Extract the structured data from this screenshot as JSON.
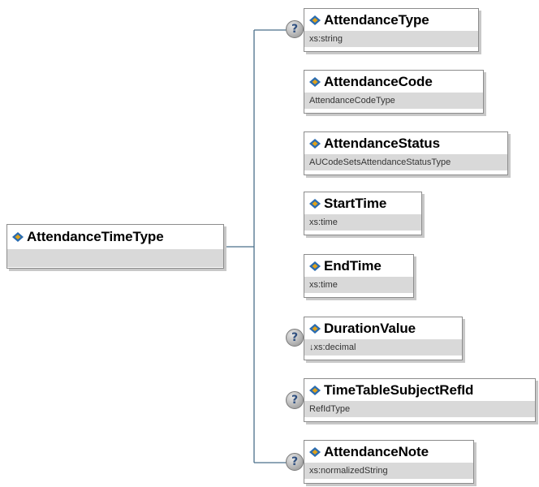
{
  "root": {
    "name": "AttendanceTimeType",
    "type": ""
  },
  "optional_marker": "?",
  "elements": [
    {
      "name": "AttendanceType",
      "type": "xs:string",
      "optional": true
    },
    {
      "name": "AttendanceCode",
      "type": "AttendanceCodeType",
      "optional": false
    },
    {
      "name": "AttendanceStatus",
      "type": "AUCodeSetsAttendanceStatusType",
      "optional": false
    },
    {
      "name": "StartTime",
      "type": "xs:time",
      "optional": false
    },
    {
      "name": "EndTime",
      "type": "xs:time",
      "optional": false
    },
    {
      "name": "DurationValue",
      "type": "↓xs:decimal",
      "optional": true
    },
    {
      "name": "TimeTableSubjectRefId",
      "type": "RefIdType",
      "optional": true
    },
    {
      "name": "AttendanceNote",
      "type": "xs:normalizedString",
      "optional": true
    }
  ],
  "colors": {
    "connector": "#4a6f8a",
    "border": "#8c8c8c",
    "type_band": "#d9d9d9",
    "icon_blue": "#2a6cb0",
    "icon_gold": "#e0a21a"
  }
}
